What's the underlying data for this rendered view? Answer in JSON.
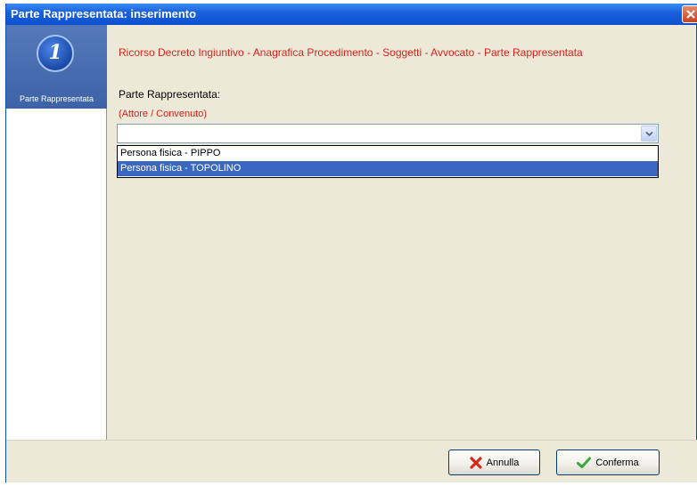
{
  "window": {
    "title": "Parte Rappresentata: inserimento"
  },
  "sidebar": {
    "steps": [
      {
        "number": "1",
        "label": "Parte Rappresentata"
      }
    ]
  },
  "main": {
    "breadcrumb": "Ricorso Decreto Ingiuntivo - Anagrafica Procedimento - Soggetti - Avvocato - Parte Rappresentata",
    "field_label": "Parte Rappresentata:",
    "field_sublabel": "(Attore / Convenuto)",
    "combo_value": "",
    "options": [
      {
        "label": "Persona fisica - PIPPO",
        "selected": false
      },
      {
        "label": "Persona fisica - TOPOLINO",
        "selected": true
      }
    ]
  },
  "footer": {
    "cancel_label": "Annulla",
    "confirm_label": "Conferma"
  },
  "icons": {
    "close": "close-icon",
    "dropdown": "chevron-down-icon",
    "cancel": "red-x-icon",
    "confirm": "green-checkmark-icon"
  },
  "colors": {
    "title_bar": "#0c4fd0",
    "breadcrumb_text": "#e0201a",
    "selected_item": "#3a68c0",
    "cancel_icon": "#d42a1a",
    "confirm_icon": "#3aa83a"
  }
}
